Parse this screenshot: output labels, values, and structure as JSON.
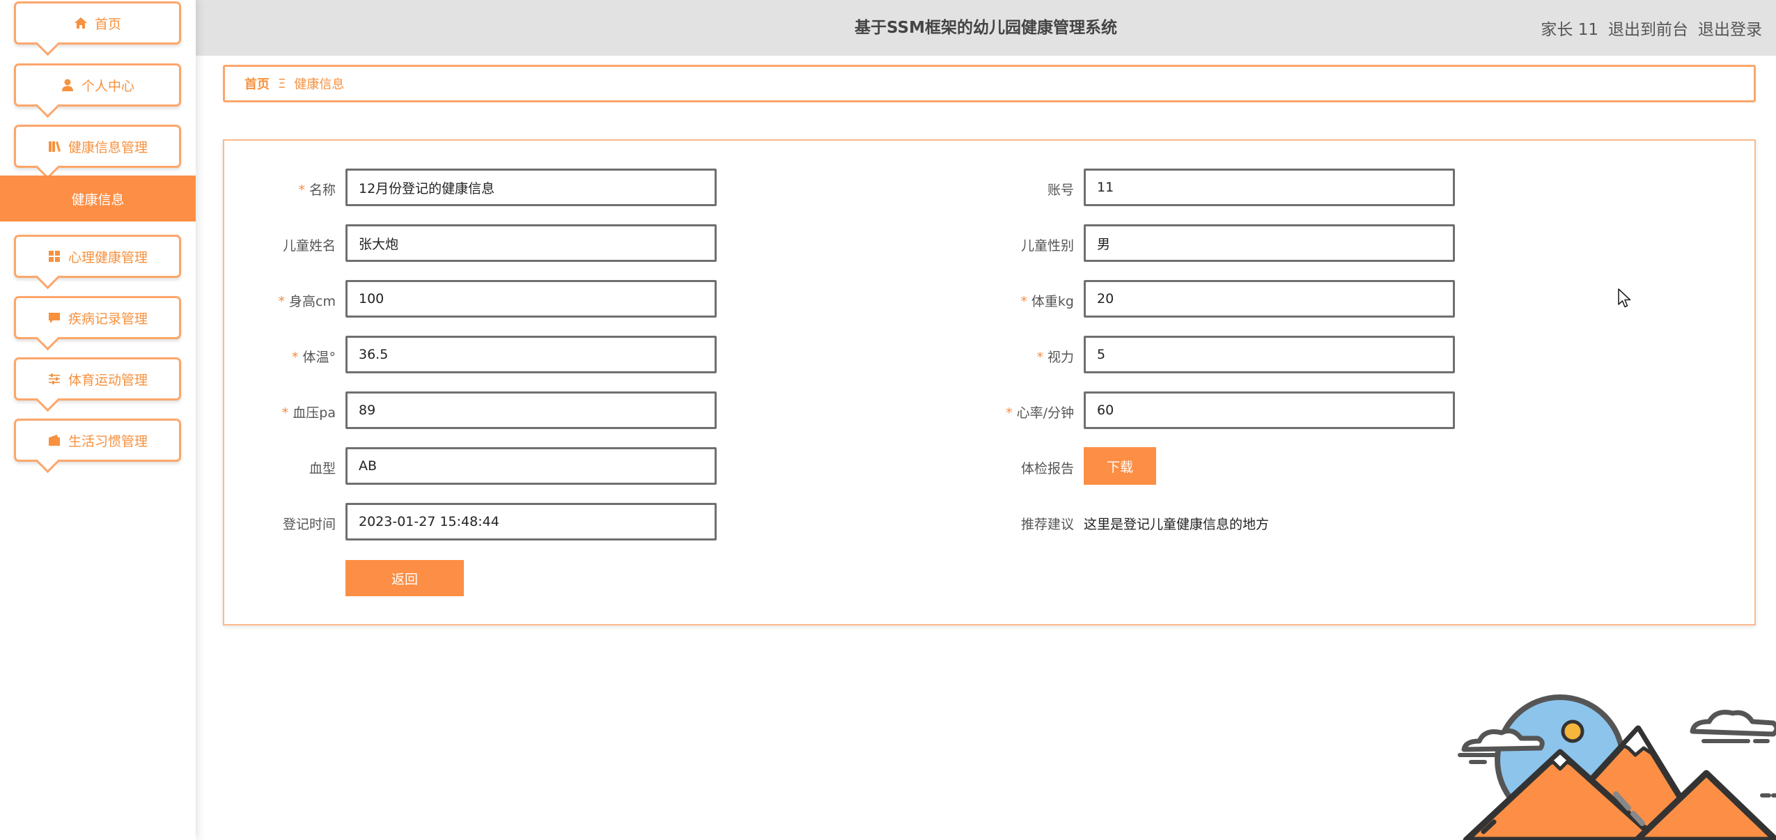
{
  "app": {
    "title": "基于SSM框架的幼儿园健康管理系统"
  },
  "header": {
    "user_label": "家长 11",
    "front_link": "退出到前台",
    "logout_link": "退出登录"
  },
  "sidebar": {
    "items": [
      {
        "label": "首页",
        "icon": "home-icon"
      },
      {
        "label": "个人中心",
        "icon": "user-icon"
      },
      {
        "label": "健康信息管理",
        "icon": "book-icon"
      },
      {
        "label": "心理健康管理",
        "icon": "grid-icon"
      },
      {
        "label": "疾病记录管理",
        "icon": "message-icon"
      },
      {
        "label": "体育运动管理",
        "icon": "sliders-icon"
      },
      {
        "label": "生活习惯管理",
        "icon": "wallet-icon"
      }
    ],
    "active_sub_item": "健康信息"
  },
  "breadcrumb": {
    "home": "首页",
    "separator": "Ξ",
    "current": "健康信息"
  },
  "form": {
    "name": {
      "label": "名称",
      "required": true,
      "value": "12月份登记的健康信息"
    },
    "account": {
      "label": "账号",
      "required": false,
      "value": "11"
    },
    "child_name": {
      "label": "儿童姓名",
      "required": false,
      "value": "张大炮"
    },
    "child_gender": {
      "label": "儿童性别",
      "required": false,
      "value": "男"
    },
    "height": {
      "label": "身高cm",
      "required": true,
      "value": "100"
    },
    "weight": {
      "label": "体重kg",
      "required": true,
      "value": "20"
    },
    "temperature": {
      "label": "体温°",
      "required": true,
      "value": "36.5"
    },
    "vision": {
      "label": "视力",
      "required": true,
      "value": "5"
    },
    "blood_pressure": {
      "label": "血压pa",
      "required": true,
      "value": "89"
    },
    "heart_rate": {
      "label": "心率/分钟",
      "required": true,
      "value": "60"
    },
    "blood_type": {
      "label": "血型",
      "required": false,
      "value": "AB"
    },
    "report": {
      "label": "体检报告",
      "button": "下载"
    },
    "register_time": {
      "label": "登记时间",
      "required": false,
      "value": "2023-01-27 15:48:44"
    },
    "advice": {
      "label": "推荐建议",
      "value": "这里是登记儿童健康信息的地方"
    },
    "return_button": "返回",
    "required_mark": "*"
  },
  "colors": {
    "accent": "#fc8f45",
    "accent_border": "#fca66a",
    "topbar_bg": "#e2e2e2"
  }
}
